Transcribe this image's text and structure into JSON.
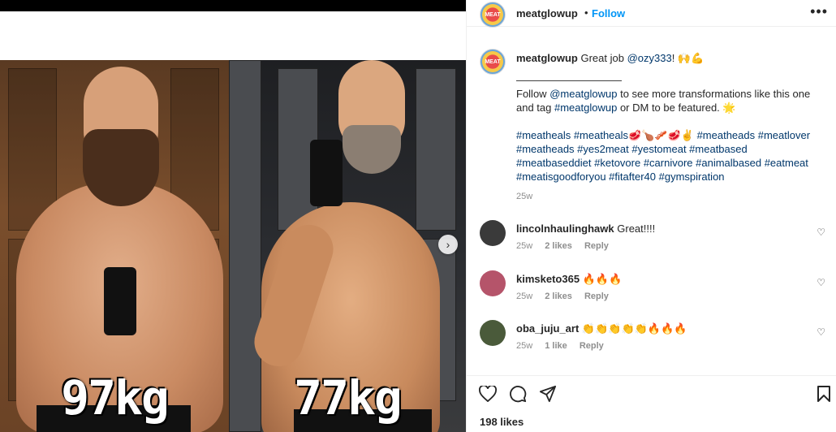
{
  "post": {
    "username": "meatglowup",
    "follow_label": "Follow",
    "separator": "•",
    "more_icon": "more-horizontal-icon",
    "before_weight": "97kg",
    "after_weight": "77kg",
    "likes": "198 likes"
  },
  "caption": {
    "username": "meatglowup",
    "intro": "Great job ",
    "mention": "@ozy333",
    "intro_end": "! 🙌💪",
    "divider": "——————————",
    "follow_prefix": "Follow ",
    "follow_mention": "@meatglowup",
    "follow_mid": " to see more transformations like this one and tag ",
    "follow_tag": "#meatglowup",
    "follow_end": " or DM to be featured. 🌟",
    "hashtags": "#meatheals #meatheals🥩🍗🥓🥩✌️ #meatheads #meatlover #meatheads #yes2meat #yestomeat #meatbased #meatbaseddiet #ketovore #carnivore #animalbased #eatmeat #meatisgoodforyou #fitafter40 #gymspiration",
    "time": "25w"
  },
  "comments": [
    {
      "username": "lincolnhaulinghawk",
      "text": "Great!!!!",
      "time": "25w",
      "likes": "2 likes",
      "reply": "Reply",
      "avatar_color": "#3a3a3a"
    },
    {
      "username": "kimsketo365",
      "text": "🔥🔥🔥",
      "time": "25w",
      "likes": "2 likes",
      "reply": "Reply",
      "avatar_color": "#b5546a"
    },
    {
      "username": "oba_juju_art",
      "text": "👏👏👏👏👏🔥🔥🔥",
      "time": "25w",
      "likes": "1 like",
      "reply": "Reply",
      "avatar_color": "#4a5a3a"
    }
  ],
  "icons": {
    "like": "heart-icon",
    "comment": "comment-icon",
    "share": "send-icon",
    "save": "bookmark-icon",
    "next": "chevron-right-icon"
  }
}
